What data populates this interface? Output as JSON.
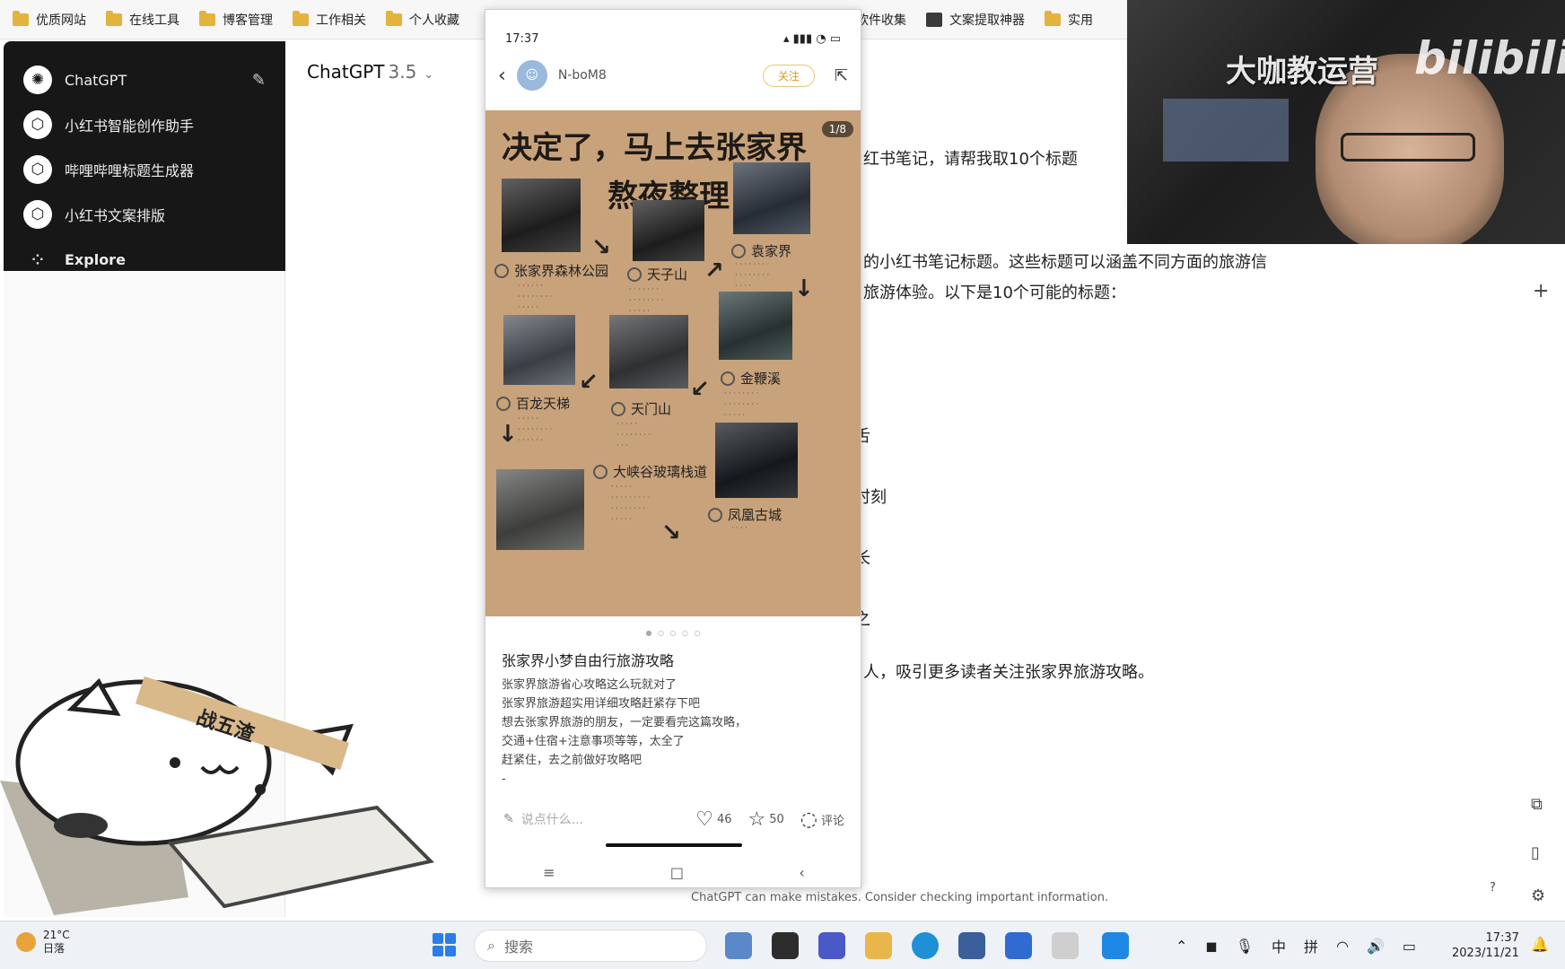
{
  "bookmarks": [
    {
      "label": "优质网站"
    },
    {
      "label": "在线工具"
    },
    {
      "label": "博客管理"
    },
    {
      "label": "工作相关"
    },
    {
      "label": "个人收藏"
    },
    {
      "label": "软件收集"
    },
    {
      "label": "文案提取神器"
    },
    {
      "label": "实用"
    }
  ],
  "sidebar": {
    "items": [
      {
        "label": "ChatGPT"
      },
      {
        "label": "小红书智能创作助手"
      },
      {
        "label": "哔哩哔哩标题生成器"
      },
      {
        "label": "小红书文案排版"
      },
      {
        "label": "Explore"
      }
    ]
  },
  "header": {
    "model": "ChatGPT",
    "version": "3.5"
  },
  "chat_fragments": [
    "红书笔记，请帮我取10个标题",
    "的小红书笔记标题。这些标题可以涵盖不同方面的旅游信",
    "旅游体验。以下是10个可能的标题：",
    "舌",
    "时刻",
    "长",
    "之",
    "人，吸引更多读者关注张家界旅游攻略。"
  ],
  "phone": {
    "time": "17:37",
    "user": "N-boM8",
    "follow": "关注",
    "poster": {
      "title": "决定了，马上去张家界",
      "subtitle": "熬夜整理",
      "page": "1/8",
      "spots": [
        {
          "name": "张家界森林公园"
        },
        {
          "name": "天子山"
        },
        {
          "name": "袁家界"
        },
        {
          "name": "百龙天梯"
        },
        {
          "name": "天门山"
        },
        {
          "name": "金鞭溪"
        },
        {
          "name": "大峡谷玻璃栈道"
        },
        {
          "name": "凤凰古城"
        }
      ]
    },
    "note_title": "张家界小梦自由行旅游攻略",
    "note_lines": [
      "张家界旅游省心攻略这么玩就对了",
      "张家界旅游超实用详细攻略赶紧存下吧",
      "想去张家界旅游的朋友，一定要看完这篇攻略，",
      "交通+住宿+注意事项等等，太全了",
      "赶紧住，去之前做好攻略吧",
      "-"
    ],
    "comment_placeholder": "说点什么...",
    "likes": "46",
    "stars": "50",
    "comments_label": "评论"
  },
  "video": {
    "overlay_text": "大咖教运营",
    "brand": "bilibili"
  },
  "sticker": {
    "band_text": "战五渣"
  },
  "disclaimer": "ChatGPT can make mistakes. Consider checking important information.",
  "taskbar": {
    "temperature": "21°C",
    "weather": "日落",
    "search_placeholder": "搜索",
    "ime_lang": "中",
    "ime_mode": "拼",
    "time": "17:37",
    "date": "2023/11/21"
  }
}
